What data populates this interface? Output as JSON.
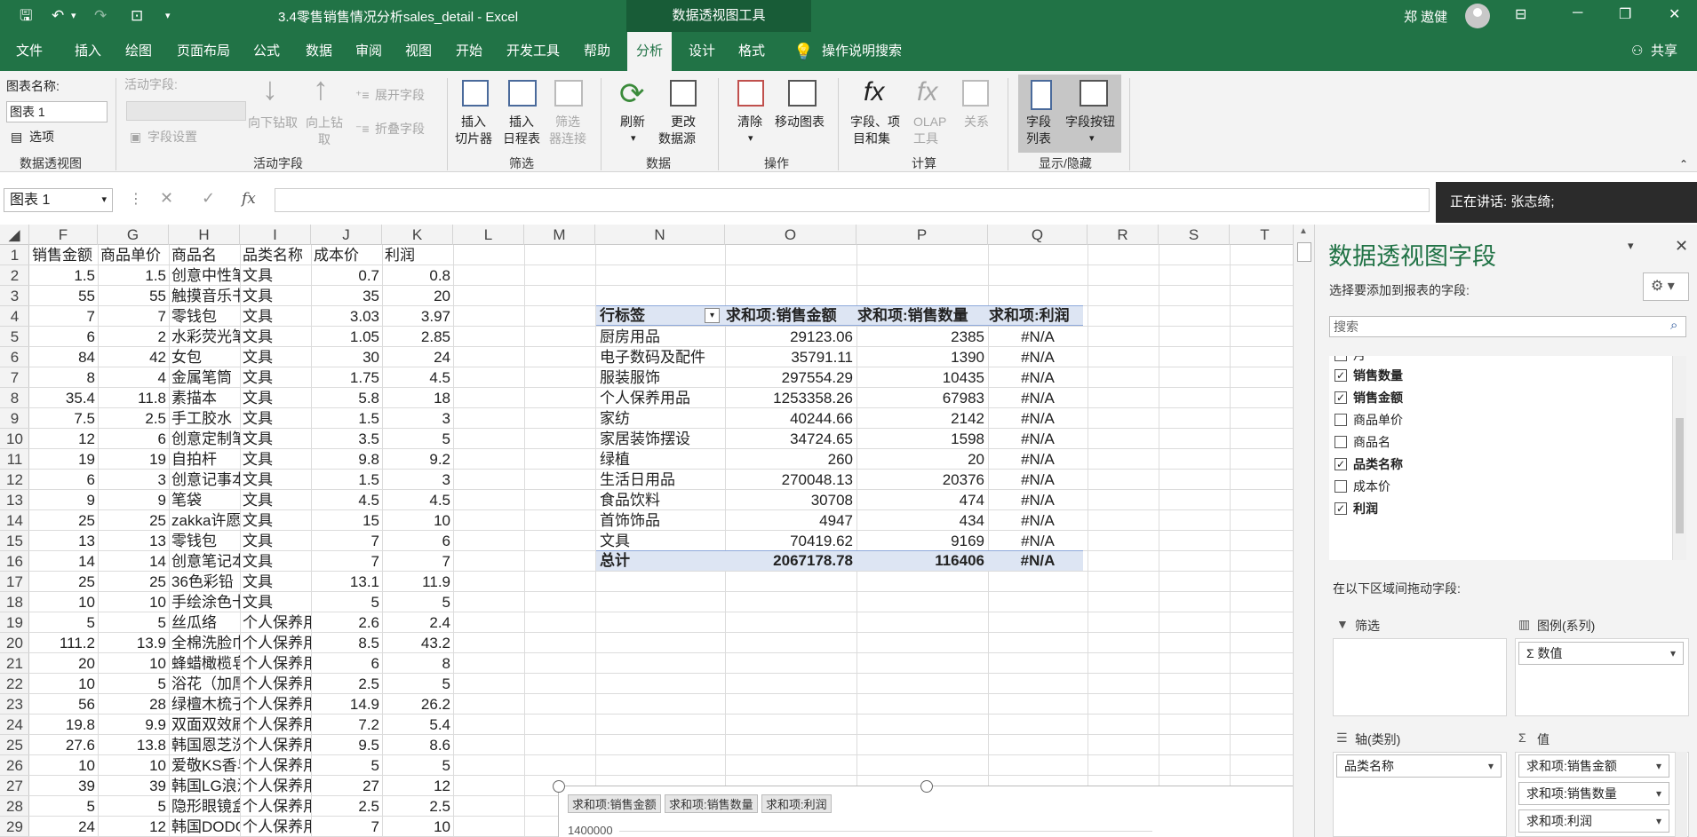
{
  "title_bar": {
    "filename": "3.4零售销售情况分析sales_detail - Excel",
    "context_tab": "数据透视图工具",
    "user": "郑 遨健"
  },
  "menu": [
    "文件",
    "插入",
    "绘图",
    "页面布局",
    "公式",
    "数据",
    "审阅",
    "视图",
    "开始",
    "开发工具",
    "帮助",
    "分析",
    "设计",
    "格式"
  ],
  "menu_active": "分析",
  "tell_me": "操作说明搜索",
  "share": "共享",
  "ribbon": {
    "chart_name_label": "图表名称:",
    "chart_name_value": "图表 1",
    "options": "选项",
    "pivot_group": "数据透视图",
    "active_field_label": "活动字段:",
    "field_settings": "字段设置",
    "drill_down": "向下钻取",
    "drill_up": "向上钻",
    "drill_up2": "取",
    "expand": "展开字段",
    "collapse": "折叠字段",
    "active_field_group": "活动字段",
    "slicer1": "插入",
    "slicer2": "切片器",
    "timeline1": "插入",
    "timeline2": "日程表",
    "filter_conn1": "筛选",
    "filter_conn2": "器连接",
    "filter_group": "筛选",
    "refresh": "刷新",
    "change_src1": "更改",
    "change_src2": "数据源",
    "data_group": "数据",
    "clear": "清除",
    "move_chart": "移动图表",
    "action_group": "操作",
    "fields_items1": "字段、项",
    "fields_items2": "目和集",
    "olap1": "OLAP",
    "olap2": "工具",
    "relations": "关系",
    "calc_group": "计算",
    "field_list1": "字段",
    "field_list2": "列表",
    "field_buttons": "字段按钮",
    "show_group": "显示/隐藏"
  },
  "formula_bar": {
    "name_box": "图表 1",
    "fx": "fx"
  },
  "speaking": "正在讲话: 张志绮;",
  "columns": [
    "F",
    "G",
    "H",
    "I",
    "J",
    "K",
    "L",
    "M",
    "N",
    "O",
    "P",
    "Q",
    "R",
    "S",
    "T"
  ],
  "rows": [
    "1",
    "2",
    "3",
    "4",
    "5",
    "6",
    "7",
    "8",
    "9",
    "10",
    "11",
    "12",
    "13",
    "14",
    "15",
    "16",
    "17",
    "18",
    "19",
    "20",
    "21",
    "22",
    "23",
    "24",
    "25",
    "26",
    "27",
    "28",
    "29"
  ],
  "headers": [
    "销售金额",
    "商品单价",
    "商品名",
    "品类名称",
    "成本价",
    "利润"
  ],
  "table": [
    [
      "1.5",
      "1.5",
      "创意中性笔",
      "文具",
      "0.7",
      "0.8"
    ],
    [
      "55",
      "55",
      "触摸音乐书",
      "文具",
      "35",
      "20"
    ],
    [
      "7",
      "7",
      "零钱包",
      "文具",
      "3.03",
      "3.97"
    ],
    [
      "6",
      "2",
      "水彩荧光笔",
      "文具",
      "1.05",
      "2.85"
    ],
    [
      "84",
      "42",
      "女包",
      "文具",
      "30",
      "24"
    ],
    [
      "8",
      "4",
      "金属笔筒",
      "文具",
      "1.75",
      "4.5"
    ],
    [
      "35.4",
      "11.8",
      "素描本",
      "文具",
      "5.8",
      "18"
    ],
    [
      "7.5",
      "2.5",
      "手工胶水",
      "文具",
      "1.5",
      "3"
    ],
    [
      "12",
      "6",
      "创意定制笔",
      "文具",
      "3.5",
      "5"
    ],
    [
      "19",
      "19",
      "自拍杆",
      "文具",
      "9.8",
      "9.2"
    ],
    [
      "6",
      "3",
      "创意记事本",
      "文具",
      "1.5",
      "3"
    ],
    [
      "9",
      "9",
      "笔袋",
      "文具",
      "4.5",
      "4.5"
    ],
    [
      "25",
      "25",
      "zakka许愿瓶",
      "文具",
      "15",
      "10"
    ],
    [
      "13",
      "13",
      "零钱包",
      "文具",
      "7",
      "6"
    ],
    [
      "14",
      "14",
      "创意笔记本",
      "文具",
      "7",
      "7"
    ],
    [
      "25",
      "25",
      "36色彩铅",
      "文具",
      "13.1",
      "11.9"
    ],
    [
      "10",
      "10",
      "手绘涂色卡",
      "文具",
      "5",
      "5"
    ],
    [
      "5",
      "5",
      "丝瓜络",
      "个人保养用品",
      "2.6",
      "2.4"
    ],
    [
      "111.2",
      "13.9",
      "全棉洗脸巾",
      "个人保养用品",
      "8.5",
      "43.2"
    ],
    [
      "20",
      "10",
      "蜂蜡橄榄皂",
      "个人保养用品",
      "6",
      "8"
    ],
    [
      "10",
      "5",
      "浴花（加厚）",
      "个人保养用品",
      "2.5",
      "5"
    ],
    [
      "56",
      "28",
      "绿檀木梳子",
      "个人保养用品",
      "14.9",
      "26.2"
    ],
    [
      "19.8",
      "9.9",
      "双面双效刷",
      "个人保养用品",
      "7.2",
      "5.4"
    ],
    [
      "27.6",
      "13.8",
      "韩国恩芝洗发",
      "个人保养用品",
      "9.5",
      "8.6"
    ],
    [
      "10",
      "10",
      "爱敬KS香皂",
      "个人保养用品",
      "5",
      "5"
    ],
    [
      "39",
      "39",
      "韩国LG浪漫",
      "个人保养用品",
      "27",
      "12"
    ],
    [
      "5",
      "5",
      "隐形眼镜盒",
      "个人保养用品",
      "2.5",
      "2.5"
    ],
    [
      "24",
      "12",
      "韩国DODO",
      "个人保养用品",
      "7",
      "10"
    ]
  ],
  "pivot": {
    "headers": [
      "行标签",
      "求和项:销售金额",
      "求和项:销售数量",
      "求和项:利润"
    ],
    "rows": [
      [
        "厨房用品",
        "29123.06",
        "2385",
        "#N/A"
      ],
      [
        "电子数码及配件",
        "35791.11",
        "1390",
        "#N/A"
      ],
      [
        "服装服饰",
        "297554.29",
        "10435",
        "#N/A"
      ],
      [
        "个人保养用品",
        "1253358.26",
        "67983",
        "#N/A"
      ],
      [
        "家纺",
        "40244.66",
        "2142",
        "#N/A"
      ],
      [
        "家居装饰摆设",
        "34724.65",
        "1598",
        "#N/A"
      ],
      [
        "绿植",
        "260",
        "20",
        "#N/A"
      ],
      [
        "生活日用品",
        "270048.13",
        "20376",
        "#N/A"
      ],
      [
        "食品饮料",
        "30708",
        "474",
        "#N/A"
      ],
      [
        "首饰饰品",
        "4947",
        "434",
        "#N/A"
      ],
      [
        "文具",
        "70419.62",
        "9169",
        "#N/A"
      ]
    ],
    "total": [
      "总计",
      "2067178.78",
      "116406",
      "#N/A"
    ]
  },
  "chart": {
    "chips": [
      "求和项:销售金额",
      "求和项:销售数量",
      "求和项:利润"
    ],
    "y_top_tick": "1400000"
  },
  "pane": {
    "title": "数据透视图字段",
    "choose": "选择要添加到报表的字段:",
    "search": "搜索",
    "fields": [
      {
        "name": "月",
        "checked": false
      },
      {
        "name": "销售数量",
        "checked": true
      },
      {
        "name": "销售金额",
        "checked": true
      },
      {
        "name": "商品单价",
        "checked": false
      },
      {
        "name": "商品名",
        "checked": false
      },
      {
        "name": "品类名称",
        "checked": true
      },
      {
        "name": "成本价",
        "checked": false
      },
      {
        "name": "利润",
        "checked": true
      }
    ],
    "drag_hint": "在以下区域间拖动字段:",
    "filter_label": "筛选",
    "legend_label": "图例(系列)",
    "legend_item": "数值",
    "axis_label": "轴(类别)",
    "axis_item": "品类名称",
    "values_label": "值",
    "values_items": [
      "求和项:销售金额",
      "求和项:销售数量",
      "求和项:利润"
    ]
  }
}
